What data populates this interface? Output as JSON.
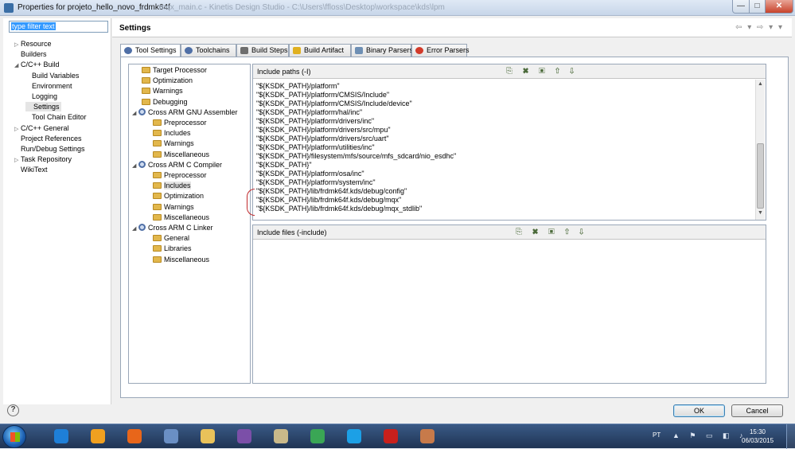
{
  "window": {
    "title": "Properties for projeto_hello_novo_frdmk64f",
    "ghost_title": "mqx_main.c - Kinetis Design Studio - C:\\Users\\ffloss\\Desktop\\workspace\\kds\\lpm",
    "controls": {
      "minimize": "—",
      "maximize": "□",
      "close": "✕"
    }
  },
  "filter": {
    "placeholder": "type filter text"
  },
  "nav_tree": [
    {
      "label": "Resource",
      "expand": "▷"
    },
    {
      "label": "Builders",
      "expand": ""
    },
    {
      "label": "C/C++ Build",
      "expand": "◢"
    },
    {
      "label": "Build Variables",
      "expand": ""
    },
    {
      "label": "Environment",
      "expand": ""
    },
    {
      "label": "Logging",
      "expand": ""
    },
    {
      "label": "Settings",
      "expand": ""
    },
    {
      "label": "Tool Chain Editor",
      "expand": ""
    },
    {
      "label": "C/C++ General",
      "expand": "▷"
    },
    {
      "label": "Project References",
      "expand": ""
    },
    {
      "label": "Run/Debug Settings",
      "expand": ""
    },
    {
      "label": "Task Repository",
      "expand": "▷"
    },
    {
      "label": "WikiText",
      "expand": ""
    }
  ],
  "settings": {
    "heading": "Settings",
    "nav_arrows": "⇦ ▾ ⇨ ▾ ▾"
  },
  "tabs": [
    {
      "label": "Tool Settings",
      "icon": "gear-icon"
    },
    {
      "label": "Toolchains",
      "icon": "gear-icon"
    },
    {
      "label": "Build Steps",
      "icon": "hammer-icon"
    },
    {
      "label": "Build Artifact",
      "icon": "star-icon"
    },
    {
      "label": "Binary Parsers",
      "icon": "document-icon"
    },
    {
      "label": "Error Parsers",
      "icon": "error-icon"
    }
  ],
  "tool_tree": [
    {
      "label": "Target Processor",
      "kind": "folder",
      "expand": ""
    },
    {
      "label": "Optimization",
      "kind": "folder",
      "expand": ""
    },
    {
      "label": "Warnings",
      "kind": "folder",
      "expand": ""
    },
    {
      "label": "Debugging",
      "kind": "folder",
      "expand": ""
    },
    {
      "label": "Cross ARM GNU Assembler",
      "kind": "gear",
      "expand": "◢"
    },
    {
      "label": "Preprocessor",
      "kind": "folder",
      "expand": ""
    },
    {
      "label": "Includes",
      "kind": "folder",
      "expand": ""
    },
    {
      "label": "Warnings",
      "kind": "folder",
      "expand": ""
    },
    {
      "label": "Miscellaneous",
      "kind": "folder",
      "expand": ""
    },
    {
      "label": "Cross ARM C Compiler",
      "kind": "gear",
      "expand": "◢"
    },
    {
      "label": "Preprocessor",
      "kind": "folder",
      "expand": ""
    },
    {
      "label": "Includes",
      "kind": "folder",
      "expand": ""
    },
    {
      "label": "Optimization",
      "kind": "folder",
      "expand": ""
    },
    {
      "label": "Warnings",
      "kind": "folder",
      "expand": ""
    },
    {
      "label": "Miscellaneous",
      "kind": "folder",
      "expand": ""
    },
    {
      "label": "Cross ARM C Linker",
      "kind": "gear",
      "expand": "◢"
    },
    {
      "label": "General",
      "kind": "folder",
      "expand": ""
    },
    {
      "label": "Libraries",
      "kind": "folder",
      "expand": ""
    },
    {
      "label": "Miscellaneous",
      "kind": "folder",
      "expand": ""
    }
  ],
  "include_paths": {
    "title": "Include paths (-I)",
    "tools": "⎘ ✖ ▣ ⇧ ⇩",
    "paths": [
      "\"${KSDK_PATH}/platform\"",
      "\"${KSDK_PATH}/platform/CMSIS/Include\"",
      "\"${KSDK_PATH}/platform/CMSIS/Include/device\"",
      "\"${KSDK_PATH}/platform/hal/inc\"",
      "\"${KSDK_PATH}/platform/drivers/inc\"",
      "\"${KSDK_PATH}/platform/drivers/src/mpu\"",
      "\"${KSDK_PATH}/platform/drivers/src/uart\"",
      "\"${KSDK_PATH}/platform/utilities/inc\"",
      "\"${KSDK_PATH}/filesystem/mfs/source/mfs_sdcard/nio_esdhc\"",
      "\"${KSDK_PATH}\"",
      "\"${KSDK_PATH}/platform/osa/inc\"",
      "\"${KSDK_PATH}/platform/system/inc\"",
      "\"${KSDK_PATH}/lib/frdmk64f.kds/debug/config\"",
      "\"${KSDK_PATH}/lib/frdmk64f.kds/debug/mqx\"",
      "\"${KSDK_PATH}/lib/frdmk64f.kds/debug/mqx_stdlib\""
    ]
  },
  "include_files": {
    "title": "Include files (-include)",
    "tools": "⎘ ✖ ▣ ⇧ ⇩"
  },
  "buttons": {
    "help": "?",
    "ok": "OK",
    "cancel": "Cancel"
  },
  "taskbar": {
    "language": "PT",
    "tray_icons": "▲ ⚑ ▭ ◧ ♪",
    "time": "15:30",
    "date": "06/03/2015",
    "apps": [
      {
        "name": "internet-explorer-icon",
        "color": "#1e7fd8"
      },
      {
        "name": "media-player-icon",
        "color": "#f0a020"
      },
      {
        "name": "firefox-icon",
        "color": "#e8661a"
      },
      {
        "name": "thunderbird-icon",
        "color": "#6a8fc4"
      },
      {
        "name": "file-explorer-icon",
        "color": "#e9c25a"
      },
      {
        "name": "viber-icon",
        "color": "#7b4fa8"
      },
      {
        "name": "scanner-icon",
        "color": "#c9b98a"
      },
      {
        "name": "chrome-icon",
        "color": "#3aa655"
      },
      {
        "name": "skype-icon",
        "color": "#1ca0e6"
      },
      {
        "name": "pdf-reader-icon",
        "color": "#c8201c"
      },
      {
        "name": "kinetis-design-studio-icon",
        "color": "#c77a4a"
      }
    ]
  }
}
